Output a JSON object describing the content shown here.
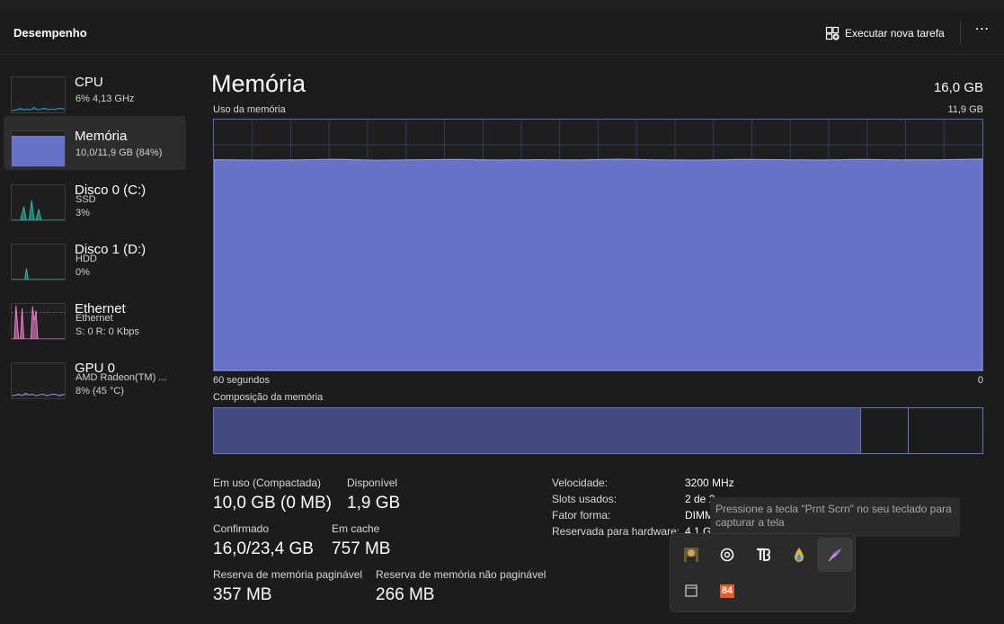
{
  "header": {
    "title": "Desempenho",
    "run_task_label": "Executar nova tarefa",
    "more_label": "⋯"
  },
  "sidebar": {
    "items": [
      {
        "name": "CPU",
        "line1": "6% 4,13 GHz",
        "line2": "",
        "icon": "cpu-graph-icon",
        "color": "#17a7d2",
        "active": false
      },
      {
        "name": "Memória",
        "line1": "10,0/11,9 GB (84%)",
        "line2": "",
        "icon": "memory-graph-icon",
        "color": "#7181d6",
        "active": true
      },
      {
        "name": "Disco 0 (C:)",
        "line1": "SSD",
        "line2": "3%",
        "icon": "disk-graph-icon",
        "color": "#2fb9a5",
        "active": false
      },
      {
        "name": "Disco 1 (D:)",
        "line1": "HDD",
        "line2": "0%",
        "icon": "disk-graph-icon",
        "color": "#2fb9a5",
        "active": false
      },
      {
        "name": "Ethernet",
        "line1": "Ethernet",
        "line2": "S: 0 R: 0 Kbps",
        "icon": "network-graph-icon",
        "color": "#e87fc8",
        "active": false
      },
      {
        "name": "GPU 0",
        "line1": "AMD Radeon(TM) ...",
        "line2": "8% (45 °C)",
        "icon": "gpu-graph-icon",
        "color": "#9b8fd6",
        "active": false
      }
    ]
  },
  "main": {
    "title": "Memória",
    "total": "16,0 GB",
    "usage_label": "Uso da memória",
    "usage_max": "11,9 GB",
    "time_label": "60 segundos",
    "time_zero": "0",
    "composition_label": "Composição da memória",
    "usage_fraction": 0.84
  },
  "stats": {
    "in_use_label": "Em uso (Compactada)",
    "in_use_value": "10,0 GB (0 MB)",
    "available_label": "Disponível",
    "available_value": "1,9 GB",
    "committed_label": "Confirmado",
    "committed_value": "16,0/23,4 GB",
    "cached_label": "Em cache",
    "cached_value": "757 MB",
    "paged_label": "Reserva de memória paginável",
    "paged_value": "357 MB",
    "nonpaged_label": "Reserva de memória não paginável",
    "nonpaged_value": "266 MB"
  },
  "specs": {
    "speed_label": "Velocidade:",
    "speed_value": "3200 MHz",
    "slots_label": "Slots usados:",
    "slots_value": "2 de 2",
    "form_label": "Fator forma:",
    "form_value": "DIMM",
    "reserved_label": "Reservada para hardware:",
    "reserved_value": "4,1 GB"
  },
  "tooltip": {
    "text": "Pressione a tecla \"Prnt Scrn\" no seu teclado para capturar a tela"
  },
  "tray": {
    "badge_text": "84",
    "icons": [
      "user-avatar-icon",
      "copilot-icon",
      "tb-app-icon",
      "droplet-icon",
      "feather-icon",
      "window-icon",
      "badge-84-icon"
    ]
  },
  "colors": {
    "memory_fill": "#6673c6",
    "memory_line": "#8c96e0",
    "accent_pink": "#e87fc8",
    "accent_teal": "#2fb9a5",
    "accent_blue": "#17a7d2"
  }
}
